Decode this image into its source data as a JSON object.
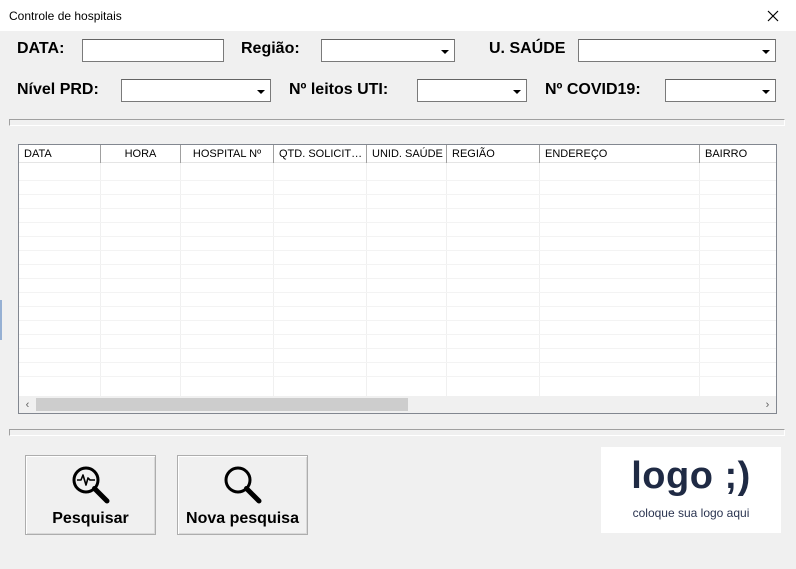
{
  "window": {
    "title": "Controle de hospitais",
    "close_glyph": "×"
  },
  "filters": {
    "data_label": "DATA:",
    "regiao_label": "Região:",
    "usaude_label": "U. SAÚDE",
    "nivel_label": "Nível PRD:",
    "leitos_label": "Nº leitos UTI:",
    "covid_label": "Nº COVID19:",
    "data_value": "",
    "regiao_value": "",
    "usaude_value": "",
    "nivel_value": "",
    "leitos_value": "",
    "covid_value": ""
  },
  "table": {
    "columns": [
      "DATA",
      "HORA",
      "HOSPITAL Nº",
      "QTD. SOLICIT…",
      "UNID. SAÚDE",
      "REGIÃO",
      "ENDEREÇO",
      "BAIRRO"
    ],
    "rows": [],
    "scroll_left_glyph": "‹",
    "scroll_right_glyph": "›"
  },
  "buttons": {
    "pesquisar_label": "Pesquisar",
    "nova_label": "Nova pesquisa",
    "pesquisar_icon": "search-pulse-icon",
    "nova_icon": "search-icon"
  },
  "logo": {
    "main_text": "logo ;)",
    "sub_text": "coloque sua logo aqui"
  }
}
